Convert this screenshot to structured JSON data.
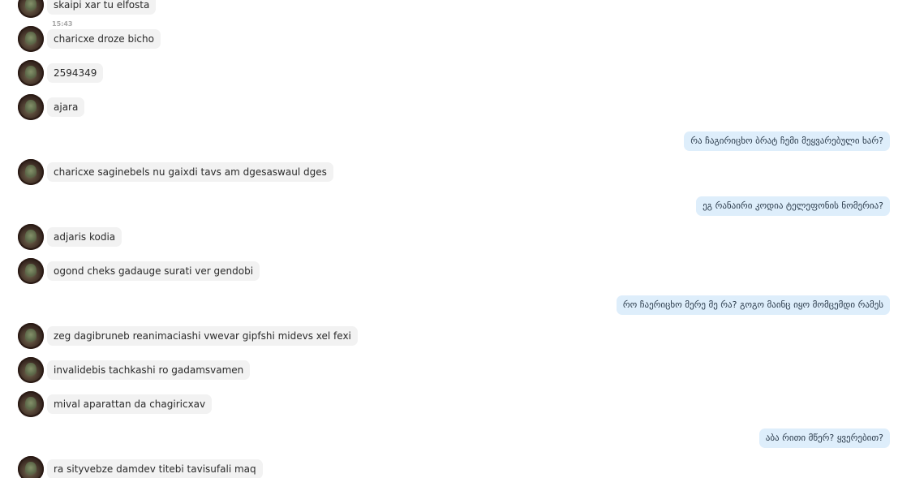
{
  "timestamp": "15:43",
  "messages": [
    {
      "direction": "in",
      "text": "skaipi xar tu elfosta"
    },
    {
      "direction": "in",
      "text": "charicxe droze bicho"
    },
    {
      "direction": "in",
      "text": "2594349"
    },
    {
      "direction": "in",
      "text": "ajara"
    },
    {
      "direction": "out",
      "text": "რა ჩაგირიცხო ბრატ ჩემი მეყვარებული ხარ?"
    },
    {
      "direction": "in",
      "text": "charicxe saginebels nu gaixdi tavs am dgesaswaul dges"
    },
    {
      "direction": "out",
      "text": "ეგ რანაირი კოდია ტელეფონის ნომერია?"
    },
    {
      "direction": "in",
      "text": "adjaris kodia"
    },
    {
      "direction": "in",
      "text": "ogond cheks gadauge surati ver gendobi"
    },
    {
      "direction": "out",
      "text": "რო ჩაერიცხო მერე მე რა? გოგო მაინც იყო მომცემდი რამეს"
    },
    {
      "direction": "in",
      "text": "zeg dagibruneb reanimaciashi vwevar gipfshi midevs xel fexi"
    },
    {
      "direction": "in",
      "text": "invalidebis tachkashi ro gadamsvamen"
    },
    {
      "direction": "in",
      "text": "mival aparattan da chagiricxav"
    },
    {
      "direction": "out",
      "text": "აბა რითი მწერ? ყვერებით?"
    },
    {
      "direction": "in",
      "text": "ra sityvebze damdev titebi tavisufali maq"
    }
  ]
}
